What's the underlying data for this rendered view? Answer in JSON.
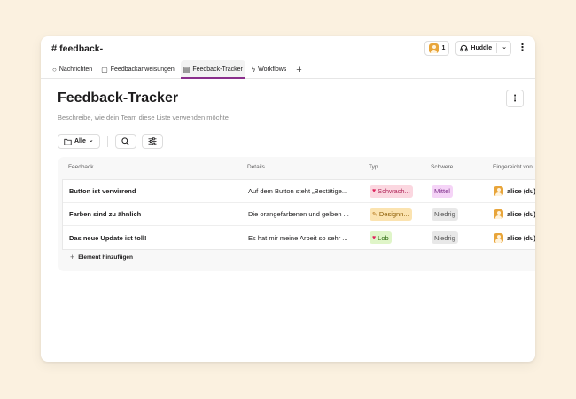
{
  "channel": {
    "hash": "#",
    "name": "feedback-"
  },
  "header": {
    "member_count": "1",
    "huddle_label": "Huddle",
    "huddle_caret": "⌄",
    "kebab": "⋮"
  },
  "tabs": [
    {
      "icon": "○",
      "label": "Nachrichten"
    },
    {
      "icon": "▢",
      "label": "Feedbackanweisungen"
    },
    {
      "icon": "▤",
      "label": "Feedback-Tracker"
    },
    {
      "icon": "ϟ",
      "label": "Workflows"
    }
  ],
  "tab_add": "+",
  "page": {
    "title": "Feedback-Tracker",
    "description": "Beschreibe, wie dein Team diese Liste verwenden möchte",
    "kebab": "⋮"
  },
  "toolbar": {
    "view_label": "Alle",
    "view_caret": "⌄",
    "search_icon": "⌕",
    "filter_icon": "≡"
  },
  "table": {
    "columns": [
      "Feedback",
      "Details",
      "Typ",
      "Schwere",
      "Eingereicht von"
    ],
    "rows": [
      {
        "feedback": "Button ist verwirrend",
        "details": "Auf dem Button steht „Bestätige...",
        "type": {
          "emoji": "♥",
          "label": "Schwach...",
          "bg": "#fbd7e0",
          "fg": "#b0265a",
          "emo_color": "#e0245e"
        },
        "severity": {
          "label": "Mittel",
          "bg": "#f5d4f7",
          "fg": "#7d2d8a"
        },
        "by": "alice (du)"
      },
      {
        "feedback": "Farben sind zu ähnlich",
        "details": "Die orangefarbenen und gelben ...",
        "type": {
          "emoji": "✎",
          "label": "Designn...",
          "bg": "#fbe3b0",
          "fg": "#8a5a00",
          "emo_color": "#b7791f"
        },
        "severity": {
          "label": "Niedrig",
          "bg": "#e8e8e8",
          "fg": "#555555"
        },
        "by": "alice (du)"
      },
      {
        "feedback": "Das neue Update ist toll!",
        "details": "Es hat mir meine Arbeit so sehr ...",
        "type": {
          "emoji": "♥",
          "label": "Lob",
          "bg": "#dff5c8",
          "fg": "#2f6b12",
          "emo_color": "#e0245e"
        },
        "severity": {
          "label": "Niedrig",
          "bg": "#e8e8e8",
          "fg": "#555555"
        },
        "by": "alice (du)"
      }
    ],
    "add_label": "Element hinzufügen",
    "add_icon": "+"
  },
  "colors": {
    "background": "#fbf1e0",
    "accent": "#8a2f8c",
    "avatar": "#e8a53a"
  }
}
